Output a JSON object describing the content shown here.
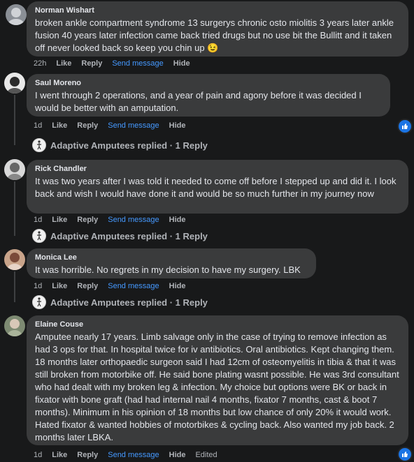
{
  "comments": [
    {
      "author": "Norman Wishart",
      "text": "broken ankle compartment syndrome 13 surgerys chronic osto miolitis 3 years later ankle fusion 40 years later infection came back tried drugs but no use bit the Bullitt and it taken off never looked back so keep you chin up 😉",
      "time": "22h",
      "like": "Like",
      "reply": "Reply",
      "send": "Send message",
      "hide": "Hide"
    },
    {
      "author": "Saul Moreno",
      "text": "I went through 2 operations, and a year of pain and agony before it was decided I would be better with an amputation.",
      "time": "1d",
      "like": "Like",
      "reply": "Reply",
      "send": "Send message",
      "hide": "Hide",
      "replies": "Adaptive Amputees replied · 1 Reply"
    },
    {
      "author": "Rick Chandler",
      "text": "It was two years after I was told it needed to come off before I stepped up and did it. I look back and wish I would have done it and would be so much further in my journey now",
      "time": "1d",
      "like": "Like",
      "reply": "Reply",
      "send": "Send message",
      "hide": "Hide",
      "replies": "Adaptive Amputees replied · 1 Reply"
    },
    {
      "author": "Monica Lee",
      "text": "It was horrible. No regrets in my decision to have my surgery. LBK",
      "time": "1d",
      "like": "Like",
      "reply": "Reply",
      "send": "Send message",
      "hide": "Hide",
      "replies": "Adaptive Amputees replied · 1 Reply"
    },
    {
      "author": "Elaine Couse",
      "text": "Amputee nearly 17 years. Limb salvage only in the case of trying to remove infection as had 3 ops for that. In hospital twice for iv antibiotics. Oral antibiotics. Kept changing them. 18 months later orthopaedic surgeon said I had 12cm of osteomyelitis in tibia & that it was still broken from motorbike off. He said bone plating wasnt possible. He was 3rd consultant who had dealt with my broken leg & infection. My choice but options were BK or back in fixator with bone graft (had had internal nail 4 months, fixator 7 months, cast & boot 7 months). Minimum in his opinion of 18 months but low chance of only 20% it would work. Hated fixator & wanted hobbies of motorbikes & cycling back. Also wanted my job back. 2 months later LBKA.",
      "time": "1d",
      "like": "Like",
      "reply": "Reply",
      "send": "Send message",
      "hide": "Hide",
      "edited": "Edited"
    }
  ],
  "colors": {
    "bg": "#18191a",
    "bubble": "#3a3b3c",
    "link": "#4599ff",
    "like_badge": "#1b74e4"
  }
}
